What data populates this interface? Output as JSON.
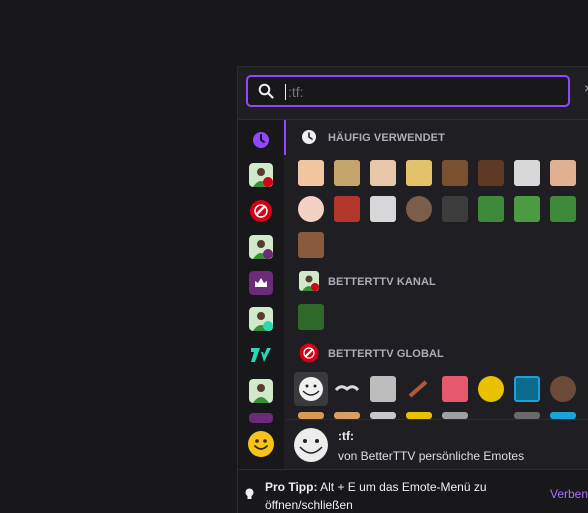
{
  "search": {
    "value": "",
    "placeholder": ":tf:"
  },
  "sections": {
    "frequent": "HÄUFIG VERWENDET",
    "channel": "BETTERTTV KANAL",
    "global": "BETTERTTV GLOBAL"
  },
  "preview": {
    "name": ":tf:",
    "source": "von BetterTTV persönliche Emotes"
  },
  "footer": {
    "tip_label": "Pro Tipp:",
    "tip_text": " Alt + E um das Emote-Menü zu öffnen/schließen",
    "link": "Verben"
  },
  "colors": {
    "accent": "#9147ff",
    "bttv_red": "#d50014",
    "pepe_green": "#3f8a3a",
    "seventv": "#29d8b4"
  },
  "sidebar_icons": [
    "clock-icon",
    "channel-avatar",
    "bttv-icon",
    "channel-avatar",
    "crown-icon",
    "channel-avatar",
    "7tv-icon",
    "channel-avatar",
    "smiley-icon"
  ]
}
